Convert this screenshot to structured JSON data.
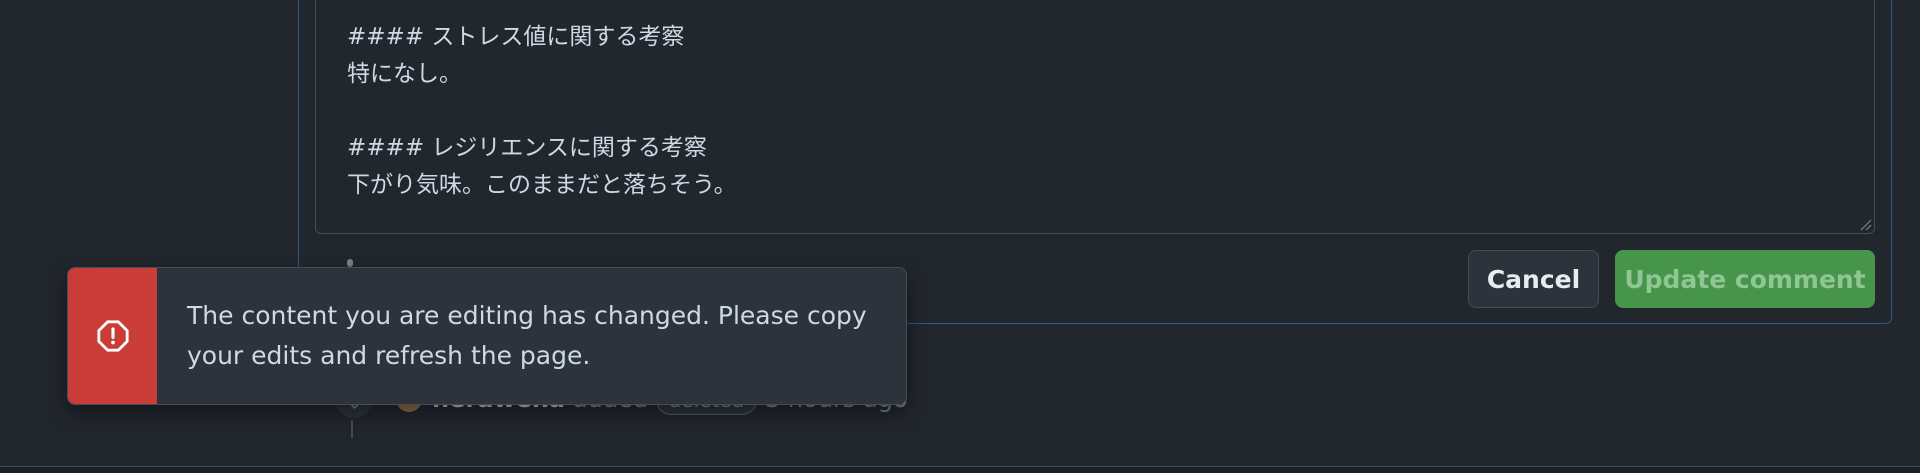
{
  "editor": {
    "lines": [
      "#### ストレス値に関する考察",
      "特になし。",
      "",
      "#### レジリエンスに関する考察",
      "下がり気味。このままだと落ちそう。"
    ]
  },
  "actions": {
    "cancel_label": "Cancel",
    "update_label": "Update comment"
  },
  "timeline": {
    "user": "herawena",
    "action": "added",
    "label": "deleted",
    "time": "3 hours ago"
  },
  "toast": {
    "message": "The content you are editing has changed. Please copy your edits and refresh the page.",
    "icon": "alert-icon"
  },
  "colors": {
    "background": "#22272e",
    "toast_accent": "#c93c37",
    "update_button": "#46954a",
    "focus_border": "#2f5a8f"
  }
}
